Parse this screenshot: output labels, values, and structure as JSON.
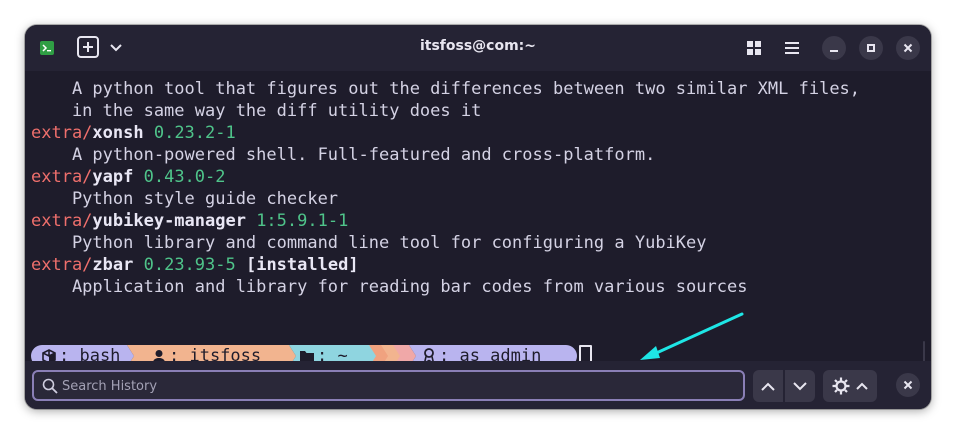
{
  "window": {
    "title": "itsfoss@com:~"
  },
  "terminal": {
    "lines": [
      {
        "kind": "desc",
        "text": "    A python tool that figures out the differences between two similar XML files,"
      },
      {
        "kind": "desc",
        "text": "    in the same way the diff utility does it"
      },
      {
        "kind": "pkg",
        "repo": "extra/",
        "name": "xonsh",
        "version": " 0.23.2-1",
        "installed": ""
      },
      {
        "kind": "desc",
        "text": "    A python-powered shell. Full-featured and cross-platform."
      },
      {
        "kind": "pkg",
        "repo": "extra/",
        "name": "yapf",
        "version": " 0.43.0-2",
        "installed": ""
      },
      {
        "kind": "desc",
        "text": "    Python style guide checker"
      },
      {
        "kind": "pkg",
        "repo": "extra/",
        "name": "yubikey-manager",
        "version": " 1:5.9.1-1",
        "installed": ""
      },
      {
        "kind": "desc",
        "text": "    Python library and command line tool for configuring a YubiKey"
      },
      {
        "kind": "pkg",
        "repo": "extra/",
        "name": "zbar",
        "version": " 0.23.93-5",
        "installed": " [installed]"
      },
      {
        "kind": "desc",
        "text": "    Application and library for reading bar codes from various sources"
      }
    ],
    "prompt": {
      "shell": ": bash",
      "user": ": itsfoss",
      "dir": ": ~",
      "role": ": as admin",
      "colors": {
        "shell": "#b9b4ef",
        "user": "#f2b48f",
        "dir": "#8fd5e0",
        "role": "#b9b4ef"
      }
    }
  },
  "search": {
    "placeholder": "Search History",
    "value": ""
  },
  "annotation": {
    "arrow_color": "#1ee6e6"
  }
}
